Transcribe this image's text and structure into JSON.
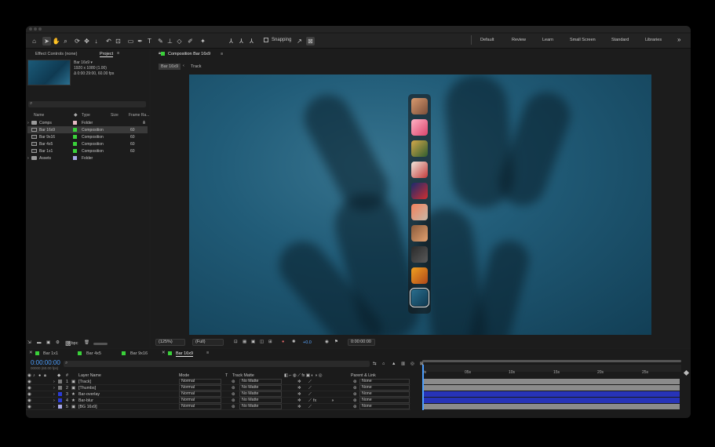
{
  "toolbar": {
    "snapping_label": "Snapping",
    "workspaces": [
      "Default",
      "Review",
      "Learn",
      "Small Screen",
      "Standard",
      "Libraries"
    ],
    "more": "»"
  },
  "project_panel": {
    "tabs": [
      "Effect Controls (none)",
      "Project"
    ],
    "menu_icon": "≡",
    "selected_name": "Bar 16x9 ▾",
    "selected_size": "1920 x 1080 (1.00)",
    "selected_duration": "Δ 0:00:29:00, 60.00 fps",
    "columns": [
      "Name",
      "Type",
      "Size",
      "Frame Ra..."
    ],
    "items": [
      {
        "name": "Comps",
        "type": "Folder",
        "fps": "",
        "color": "#e6b8c4",
        "kind": "folder"
      },
      {
        "name": "Bar 16x9",
        "type": "Composition",
        "fps": "60",
        "color": "#3ad13a",
        "kind": "comp"
      },
      {
        "name": "Bar 9x16",
        "type": "Composition",
        "fps": "60",
        "color": "#3ad13a",
        "kind": "comp"
      },
      {
        "name": "Bar 4x5",
        "type": "Composition",
        "fps": "60",
        "color": "#3ad13a",
        "kind": "comp"
      },
      {
        "name": "Bar 1x1",
        "type": "Composition",
        "fps": "60",
        "color": "#3ad13a",
        "kind": "comp"
      },
      {
        "name": "Assets",
        "type": "Folder",
        "fps": "",
        "color": "#a9a9e6",
        "kind": "folder"
      }
    ],
    "bpc": "8 bpc"
  },
  "composition": {
    "tab_label": "Composition Bar 16x9",
    "breadcrumbs": [
      "Bar 16x9",
      "Track"
    ],
    "zoom": "(125%)",
    "resolution": "(Full)",
    "exposure": "+0.0",
    "timecode": "0:00:00:00"
  },
  "dock_apps": [
    {
      "name": "app-1",
      "colors": [
        "#d99a6e",
        "#7a4e3a"
      ]
    },
    {
      "name": "app-2",
      "colors": [
        "#ffb3c6",
        "#d9436b"
      ]
    },
    {
      "name": "app-3",
      "colors": [
        "#d4a84a",
        "#2f5d2f"
      ]
    },
    {
      "name": "app-4",
      "colors": [
        "#f2e7dc",
        "#c23a3a"
      ]
    },
    {
      "name": "app-5",
      "colors": [
        "#1a2a6e",
        "#d12f2f"
      ]
    },
    {
      "name": "app-6",
      "colors": [
        "#f2805b",
        "#c7b8a8"
      ]
    },
    {
      "name": "app-7",
      "colors": [
        "#8a5a3a",
        "#e0a070"
      ]
    },
    {
      "name": "app-8",
      "colors": [
        "#2a2a2a",
        "#5a5a5a"
      ]
    },
    {
      "name": "app-9",
      "colors": [
        "#f0a020",
        "#b0481a"
      ]
    },
    {
      "name": "app-10",
      "colors": [
        "#2a6e8e",
        "#0f3a52"
      ]
    }
  ],
  "timeline": {
    "tabs": [
      "Bar 1x1",
      "Bar 4x5",
      "Bar 9x16",
      "Bar 16x9"
    ],
    "timecode": "0:00:00:00",
    "frames": "00000 (60.00 fps)",
    "headers": {
      "num": "#",
      "name": "Layer Name",
      "mode": "Mode",
      "t": "T",
      "matte": "Track Matte",
      "parent": "Parent & Link"
    },
    "ruler": [
      "0s",
      "05s",
      "10s",
      "15s",
      "20s",
      "25s"
    ],
    "layers": [
      {
        "num": "1",
        "name": "[Track]",
        "mode": "Normal",
        "matte": "No Matte",
        "parent": "None",
        "color": "#7a7a7a",
        "bar": "#8b8b8b"
      },
      {
        "num": "2",
        "name": "[Thumbs]",
        "mode": "Normal",
        "matte": "No Matte",
        "parent": "None",
        "color": "#7a7a7a",
        "bar": "#8b8b8b"
      },
      {
        "num": "3",
        "name": "Bar-overlay",
        "mode": "Normal",
        "matte": "No Matte",
        "parent": "None",
        "color": "#2b3bd6",
        "bar": "#2733b8"
      },
      {
        "num": "4",
        "name": "Bar-blur",
        "mode": "Normal",
        "matte": "No Matte",
        "parent": "None",
        "color": "#2b3bd6",
        "bar": "#2733b8"
      },
      {
        "num": "5",
        "name": "[BG 16x9]",
        "mode": "Normal",
        "matte": "No Matte",
        "parent": "None",
        "color": "#a9a9e6",
        "bar": "#8b8b8b"
      }
    ]
  }
}
